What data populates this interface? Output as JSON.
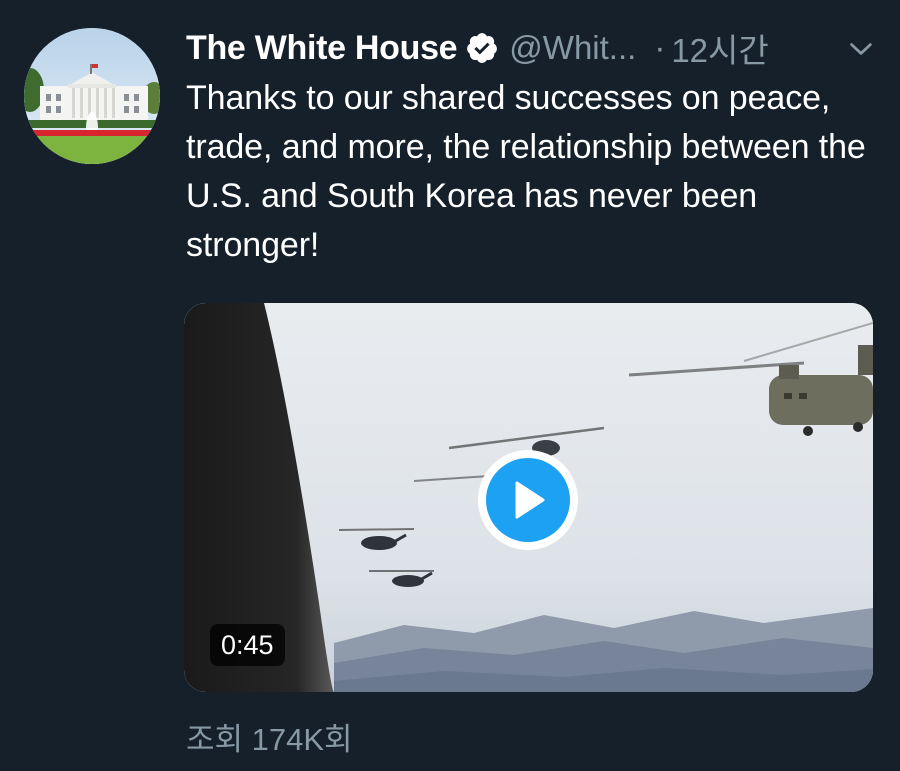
{
  "tweet": {
    "display_name": "The White House",
    "handle": "@Whit...",
    "separator": "·",
    "timestamp": "12시간",
    "text": "Thanks to our shared successes on peace, trade, and more, the relationship between the U.S. and South Korea has never been stronger!",
    "media": {
      "duration": "0:45"
    },
    "views": "조회 174K회"
  },
  "icons": {
    "verified": "verified-badge-icon",
    "caret": "chevron-down-icon",
    "play": "play-icon"
  },
  "colors": {
    "background": "#15202b",
    "secondary_text": "#8899a6",
    "accent": "#1da1f2"
  }
}
